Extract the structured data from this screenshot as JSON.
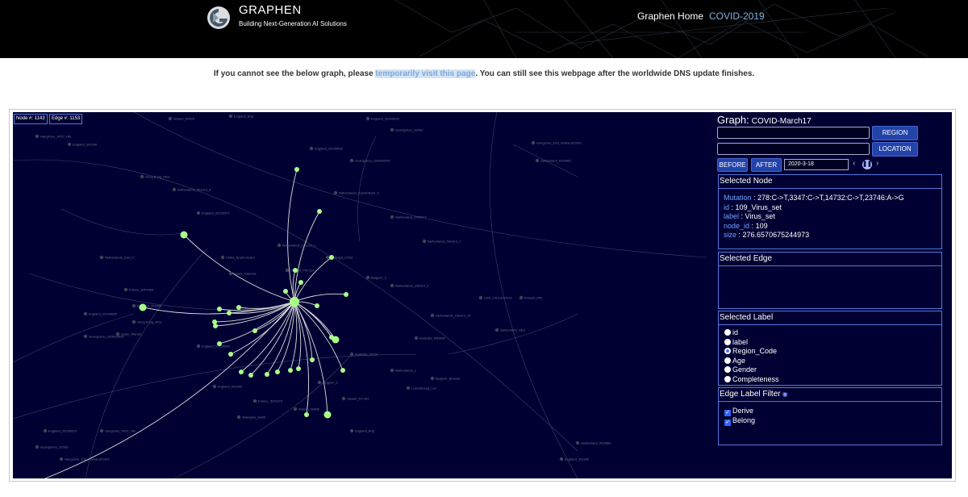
{
  "header": {
    "brand": "GRAPHEN",
    "tagline": "Building Next-Generation AI Solutions",
    "nav": [
      {
        "label": "Graphen Home",
        "active": false
      },
      {
        "label": "COVID-2019",
        "active": true
      }
    ],
    "logo_icon": "graphen-g-logo-icon"
  },
  "notice": {
    "before": "If you cannot see the below graph, please ",
    "link": "temporarily visit this page",
    "after": ". You can still see this webpage after the worldwide DNS update finishes."
  },
  "graph": {
    "node_count": "Node #: 1143",
    "edge_count": "Edge #: 1153",
    "background": "#000033",
    "node_color": "#aaff88",
    "labels": [
      "Wuhan_WH05",
      "England_Brig",
      "England_20100003",
      "Guangzhou_GZMU",
      "Hangzhou_ZJU_Wuhan201901",
      "Hangzhou_IVDC_HB",
      "England_201000",
      "Switzerland_AG0583",
      "Guangzhou_GZMU0030",
      "England_20100093",
      "Hong Kong_HKU",
      "Netherlands_Nboord_8",
      "Netherlands_ZuidHolland_9",
      "England_20100477",
      "Switzerland_1000477",
      "Netherlands_Nboord_1",
      "Netherlands_Utrecht_1",
      "China_Spain-cluster",
      "Portugal_CV63",
      "Finland_FIN-114",
      "Netherlands_Zuid_2",
      "France_IDF0363",
      "England_20100085",
      "England_201000",
      "Belgium_2",
      "Netherlands_Utrecht_3",
      "Netherlands_Utrecht_10",
      "USA_CA-CA-PG13",
      "Finland_FIN",
      "Switzerland_GE3",
      "Spain_Valencia",
      "Spain_Wuhan",
      "Australia_NSW05",
      "Australia_VIC01",
      "Netherlands_1",
      "Belgium_2",
      "Taiwan_NTU03",
      "Luxembourg_Lux",
      "Belgium_Brussel",
      "England_201000",
      "France_IDF0373",
      "Shanghai_SH05"
    ]
  },
  "panel": {
    "graph_label": "Graph:",
    "graph_name": "COVID-March17",
    "region_button": "REGION",
    "location_button": "LOCATION",
    "before_button": "BEFORE",
    "after_button": "AFTER",
    "date_value": "2020-3-18",
    "prev_icon": "chevron-left-icon",
    "pause_icon": "pause-icon",
    "next_icon": "chevron-right-icon",
    "selected_node": {
      "title": "Selected Node",
      "fields": [
        {
          "key": "Mutation",
          "value": "278:C->T,3347:C->T,14732:C->T,23746:A->G"
        },
        {
          "key": "id",
          "value": "109_Virus_set"
        },
        {
          "key": "label",
          "value": "Virus_set"
        },
        {
          "key": "node_id",
          "value": "109"
        },
        {
          "key": "size",
          "value": "276.6570675244973"
        }
      ]
    },
    "selected_edge": {
      "title": "Selected Edge"
    },
    "selected_label": {
      "title": "Selected Label",
      "options": [
        {
          "label": "id",
          "selected": false
        },
        {
          "label": "label",
          "selected": false
        },
        {
          "label": "Region_Code",
          "selected": true
        },
        {
          "label": "Age",
          "selected": false
        },
        {
          "label": "Gender",
          "selected": false
        },
        {
          "label": "Completeness",
          "selected": false
        }
      ]
    },
    "edge_label_filter": {
      "title": "Edge Label Filter",
      "icon": "eye-icon",
      "options": [
        {
          "label": "Derive",
          "checked": true
        },
        {
          "label": "Belong",
          "checked": true
        }
      ]
    }
  }
}
